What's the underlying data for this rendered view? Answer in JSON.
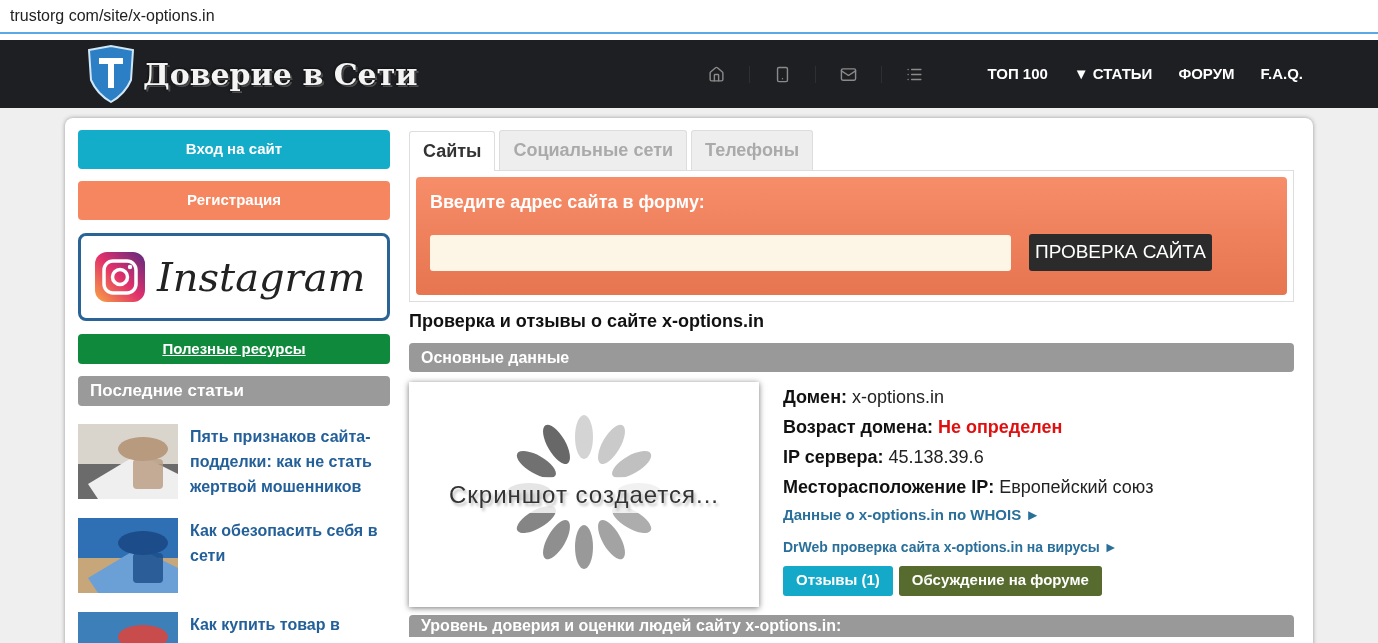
{
  "address_bar": {
    "url": "trustorg com/site/x-options.in"
  },
  "header": {
    "logo_text": "Доверие в Сети",
    "nav_links": [
      {
        "label": "ТОП 100"
      },
      {
        "label": "▼ СТАТЬИ"
      },
      {
        "label": "ФОРУМ"
      },
      {
        "label": "F.A.Q."
      }
    ]
  },
  "sidebar": {
    "login_button": "Вход на сайт",
    "register_button": "Регистрация",
    "instagram_banner": "Instagram",
    "resources_link": "Полезные ресурсы",
    "articles_heading": "Последние статьи",
    "articles": [
      {
        "title": "Пять признаков сайта-подделки: как не стать жертвой мошенников",
        "kind": "picture"
      },
      {
        "title": "Как обезопасить себя в сети",
        "kind": "picture"
      },
      {
        "title": "Как купить товар в",
        "kind": "picture"
      }
    ]
  },
  "tabs": [
    {
      "label": "Сайты",
      "selected": true
    },
    {
      "label": "Социальные сети",
      "selected": false
    },
    {
      "label": "Телефоны",
      "selected": false
    }
  ],
  "check_form": {
    "title": "Введите адрес сайта в форму:",
    "button": "ПРОВЕРКА САЙТА"
  },
  "page_title": "Проверка и отзывы о сайте x-options.in",
  "main_section": {
    "heading": "Основные данные",
    "screenshot_placeholder": "Скриншот создается...",
    "info_rows": [
      {
        "label": "Домен:",
        "value": "x-options.in",
        "alert": false
      },
      {
        "label": "Возраст домена:",
        "value": "Не определен",
        "alert": true
      },
      {
        "label": "IP сервера:",
        "value": "45.138.39.6",
        "alert": false
      },
      {
        "label": "Месторасположение IP:",
        "value": "Европейский союз",
        "alert": false
      }
    ],
    "links": [
      "Данные о x-options.in по WHOIS ►",
      "DrWeb проверка сайта x-options.in на вирусы ►"
    ],
    "reviews_button": "Отзывы (1)",
    "forum_button": "Обсуждение на форуме"
  },
  "trust_section": {
    "heading": "Уровень доверия и оценки людей сайту x-options.in:"
  }
}
